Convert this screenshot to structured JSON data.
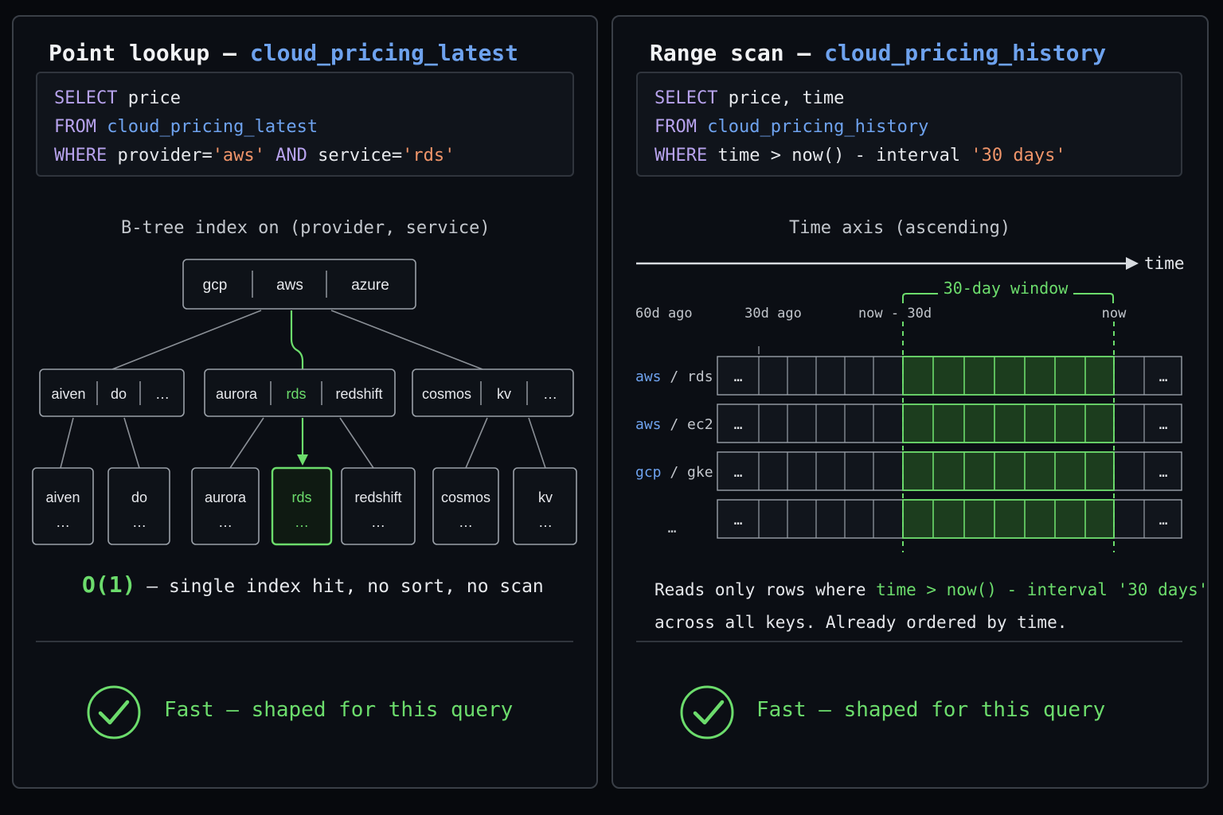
{
  "left": {
    "title_prefix": "Point lookup — ",
    "title_table": "cloud_pricing_latest",
    "sql": {
      "select_kw": "SELECT",
      "select_cols": " price",
      "from_kw": "FROM",
      "from_table": "cloud_pricing_latest",
      "where_kw": "WHERE",
      "where_a": " provider=",
      "where_a_val": "'aws'",
      "and_kw": " AND",
      "where_b": " service=",
      "where_b_val": "'rds'"
    },
    "index_caption": "B-tree index on (provider, service)",
    "root_keys": [
      "gcp",
      "aws",
      "azure"
    ],
    "mid_nodes": [
      {
        "keys": [
          "aiven",
          "do",
          "…"
        ]
      },
      {
        "keys": [
          "aurora",
          "rds",
          "redshift"
        ]
      },
      {
        "keys": [
          "cosmos",
          "kv",
          "…"
        ]
      }
    ],
    "leaves": [
      {
        "name": "aiven",
        "more": "…"
      },
      {
        "name": "do",
        "more": "…"
      },
      {
        "name": "aurora",
        "more": "…"
      },
      {
        "name": "rds",
        "more": "…"
      },
      {
        "name": "redshift",
        "more": "…"
      },
      {
        "name": "cosmos",
        "more": "…"
      },
      {
        "name": "kv",
        "more": "…"
      }
    ],
    "complexity": "O(1)",
    "complexity_text": " — single index hit, no sort, no scan",
    "verdict": "Fast — shaped for this query"
  },
  "right": {
    "title_prefix": "Range scan — ",
    "title_table": "cloud_pricing_history",
    "sql": {
      "select_kw": "SELECT",
      "select_cols": " price, time",
      "from_kw": "FROM",
      "from_table": "cloud_pricing_history",
      "where_kw": "WHERE",
      "where_expr": " time > now() - interval ",
      "where_val": "'30 days'"
    },
    "axis_caption": "Time axis (ascending)",
    "axis_label": "time",
    "window_label": "30-day window",
    "ticks": [
      "60d ago",
      "30d ago",
      "now - 30d",
      "now"
    ],
    "rows": [
      {
        "provider": "aws",
        "sep": " / ",
        "service": "rds"
      },
      {
        "provider": "aws",
        "sep": " / ",
        "service": "ec2"
      },
      {
        "provider": "gcp",
        "sep": " / ",
        "service": "gke"
      },
      {
        "provider": "",
        "sep": "",
        "service": "…"
      }
    ],
    "cell_ellipsis": "…",
    "note_line1_prefix": "Reads only rows where ",
    "note_line1_expr": "time > now() - interval '30 days'",
    "note_line2": "across all keys. Already ordered by time.",
    "verdict": "Fast — shaped for this query"
  },
  "colors": {
    "accent_green": "#6cdc6c",
    "table_blue": "#6ea2ee",
    "keyword_purple": "#b8a3ee",
    "string_orange": "#f0956a"
  }
}
